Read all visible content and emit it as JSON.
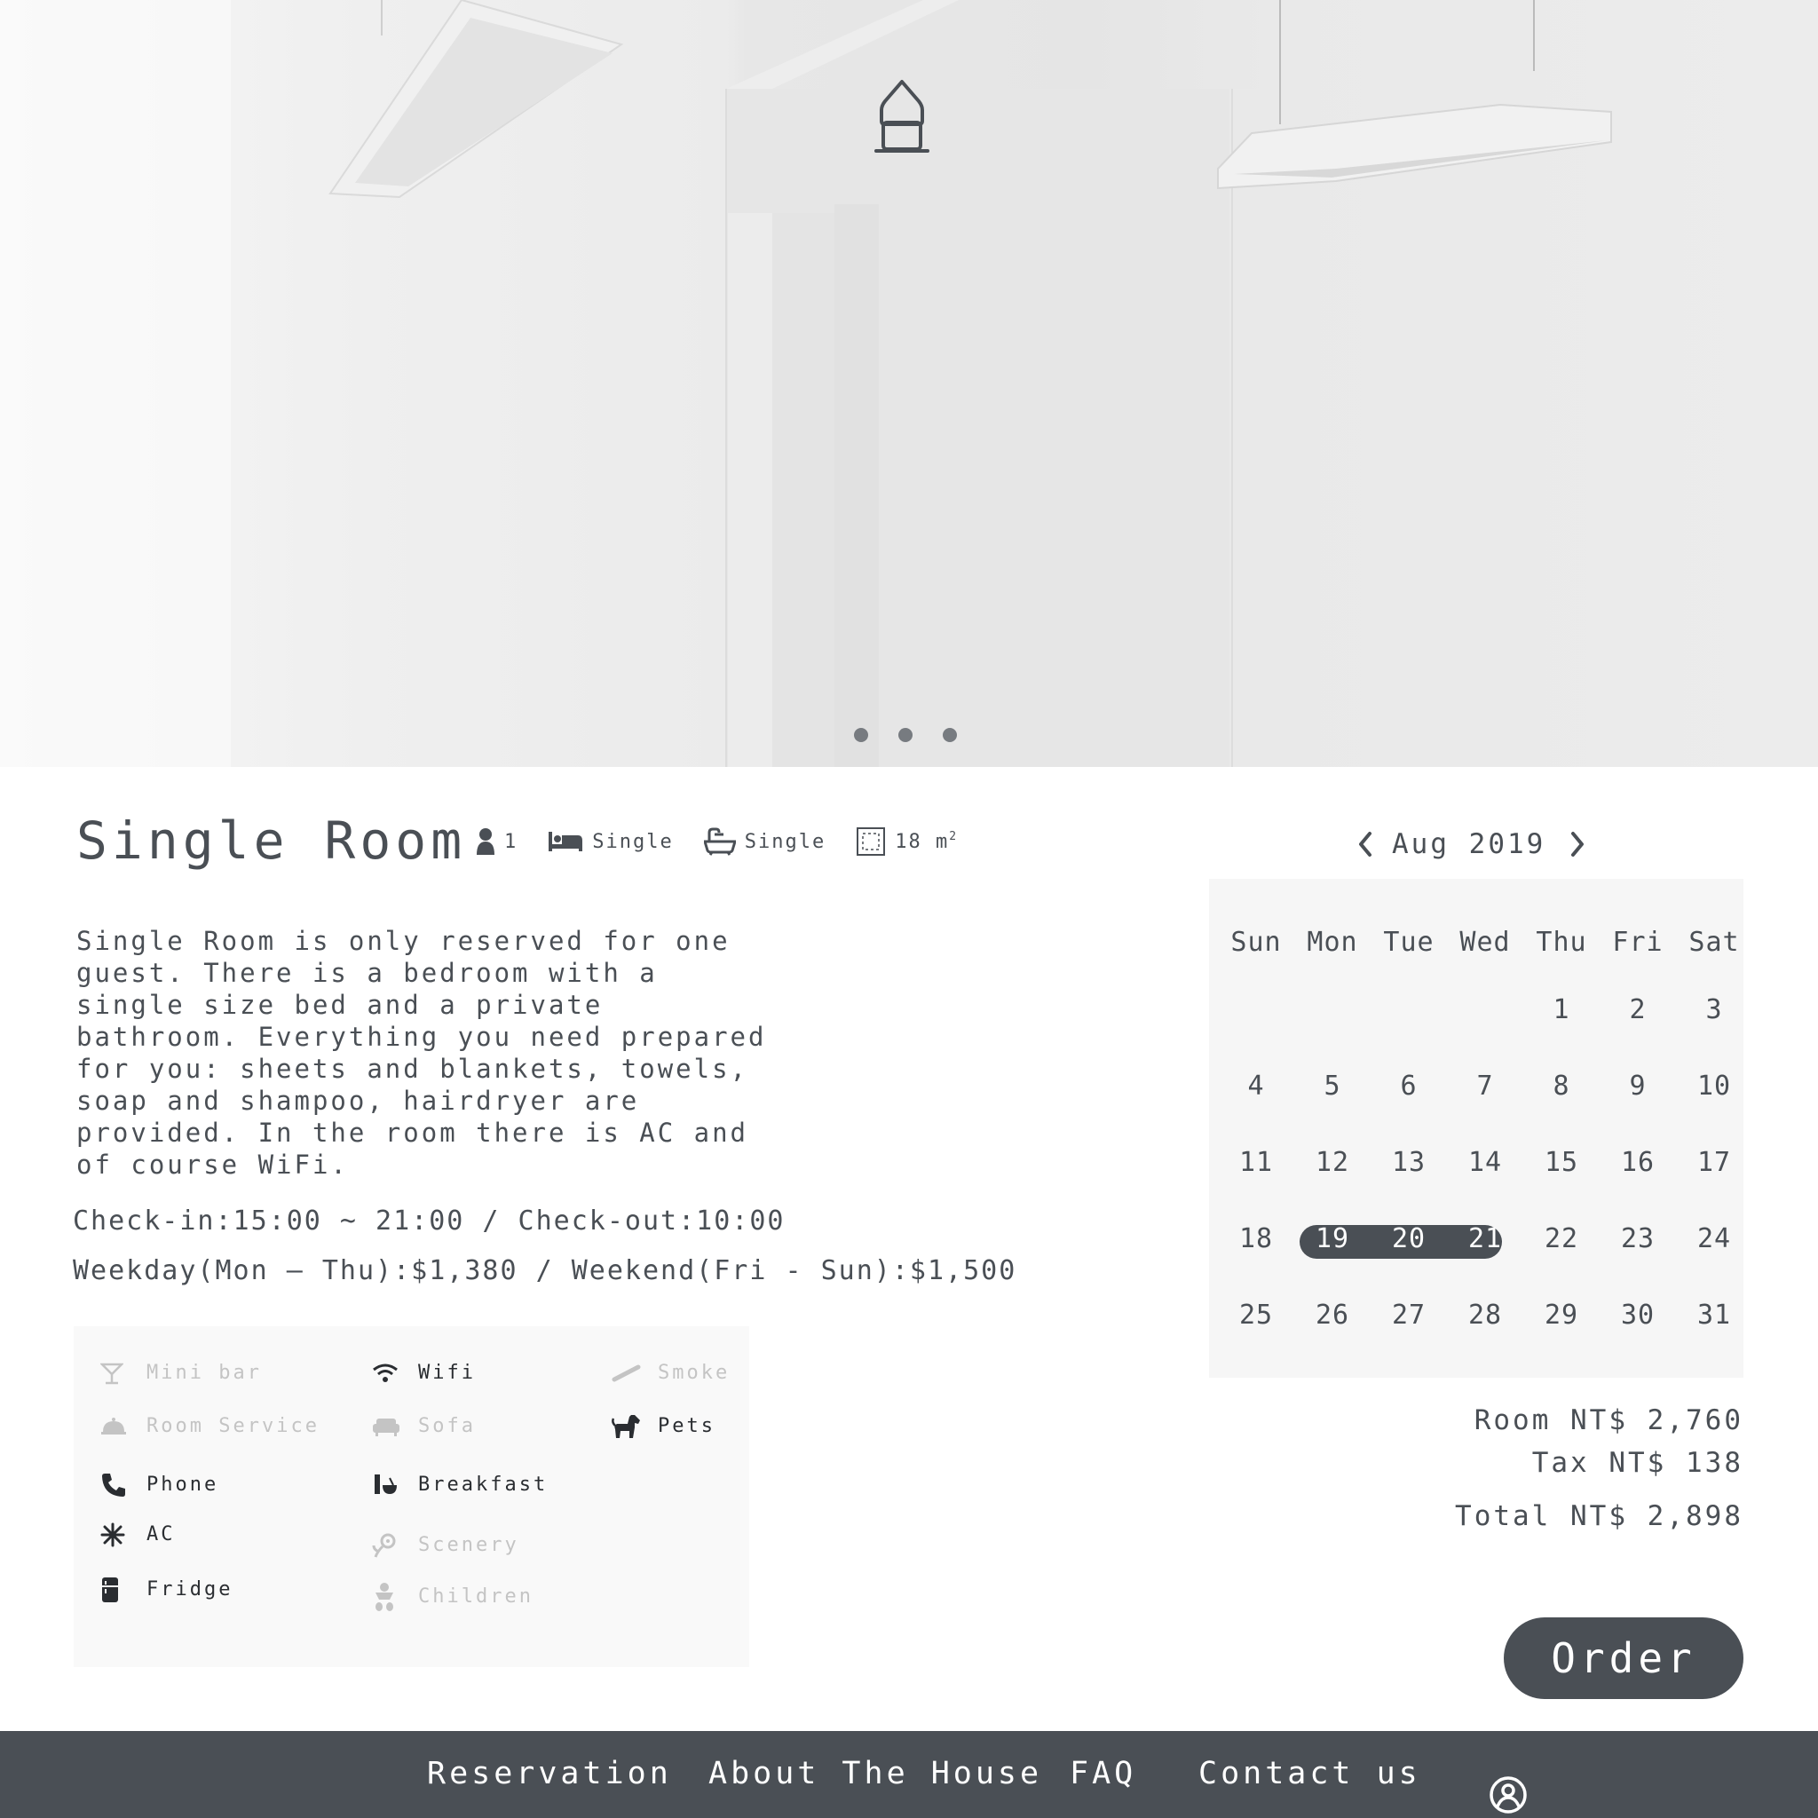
{
  "hero": {
    "slides": 3,
    "active_slide": 0
  },
  "room": {
    "title": "Single Room",
    "specs": {
      "guests": "1",
      "bed": "Single",
      "bath": "Single",
      "size": "18 m",
      "size_sup": "2"
    },
    "description": "Single Room is only reserved for one guest. There is a bedroom with a single size bed and a private bathroom. Everything you need prepared for you: sheets and blankets, towels, soap and shampoo, hairdryer are provided. In the room there is AC and of course WiFi.",
    "checkin": "Check-in:15:00 ~ 21:00 / Check-out:10:00",
    "price": "Weekday(Mon – Thu):$1,380 / Weekend(Fri - Sun):$1,500"
  },
  "amenities": [
    {
      "label": "Mini bar",
      "icon": "cocktail-icon",
      "available": false
    },
    {
      "label": "Wifi",
      "icon": "wifi-icon",
      "available": true
    },
    {
      "label": "Smoke",
      "icon": "cigarette-icon",
      "available": false
    },
    {
      "label": "Room Service",
      "icon": "cloche-icon",
      "available": false
    },
    {
      "label": "Sofa",
      "icon": "sofa-icon",
      "available": false
    },
    {
      "label": "Pets",
      "icon": "dog-icon",
      "available": true
    },
    {
      "label": "Phone",
      "icon": "phone-icon",
      "available": true
    },
    {
      "label": "Breakfast",
      "icon": "breakfast-icon",
      "available": true
    },
    {
      "label": "AC",
      "icon": "snowflake-icon",
      "available": true
    },
    {
      "label": "Scenery",
      "icon": "flower-icon",
      "available": false
    },
    {
      "label": "Fridge",
      "icon": "fridge-icon",
      "available": true
    },
    {
      "label": "Children",
      "icon": "baby-icon",
      "available": false
    }
  ],
  "calendar": {
    "month_label": "Aug 2019",
    "weekdays": [
      "Sun",
      "Mon",
      "Tue",
      "Wed",
      "Thu",
      "Fri",
      "Sat"
    ],
    "weeks": [
      [
        "",
        "",
        "",
        "",
        "1",
        "2",
        "3"
      ],
      [
        "4",
        "5",
        "6",
        "7",
        "8",
        "9",
        "10"
      ],
      [
        "11",
        "12",
        "13",
        "14",
        "15",
        "16",
        "17"
      ],
      [
        "18",
        "19",
        "20",
        "21",
        "22",
        "23",
        "24"
      ],
      [
        "25",
        "26",
        "27",
        "28",
        "29",
        "30",
        "31"
      ]
    ],
    "selected": [
      "19",
      "20",
      "21"
    ]
  },
  "totals": {
    "room": "Room NT$ 2,760",
    "tax": "Tax NT$ 138",
    "total": "Total NT$ 2,898"
  },
  "order_label": "Order",
  "footer": {
    "nav": [
      "Reservation",
      "About The House",
      "FAQ",
      "Contact us"
    ]
  },
  "colors": {
    "primary": "#4a4f55",
    "muted": "#c4c4c4",
    "calendar_bg": "#f6f6f6",
    "amenity_bg": "#f9f9f9"
  }
}
